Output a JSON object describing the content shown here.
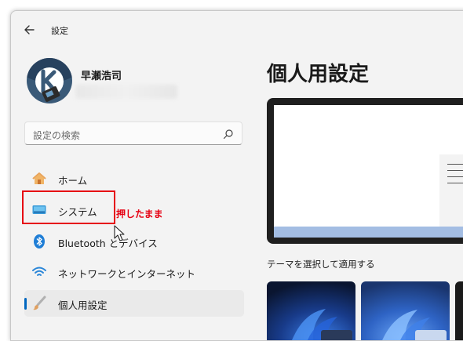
{
  "window": {
    "title": "設定"
  },
  "profile": {
    "name": "早瀬浩司"
  },
  "search": {
    "placeholder": "設定の検索"
  },
  "nav": [
    {
      "label": "ホーム",
      "icon": "home-icon"
    },
    {
      "label": "システム",
      "icon": "system-icon"
    },
    {
      "label": "Bluetooth とデバイス",
      "icon": "bluetooth-icon"
    },
    {
      "label": "ネットワークとインターネット",
      "icon": "network-icon"
    },
    {
      "label": "個人用設定",
      "icon": "brush-icon",
      "selected": true
    }
  ],
  "annotation": {
    "text": "押したまま",
    "color": "#e60012"
  },
  "main": {
    "title": "個人用設定",
    "theme_label": "テーマを選択して適用する"
  },
  "colors": {
    "accent": "#0067c0",
    "highlight": "#e60012"
  }
}
